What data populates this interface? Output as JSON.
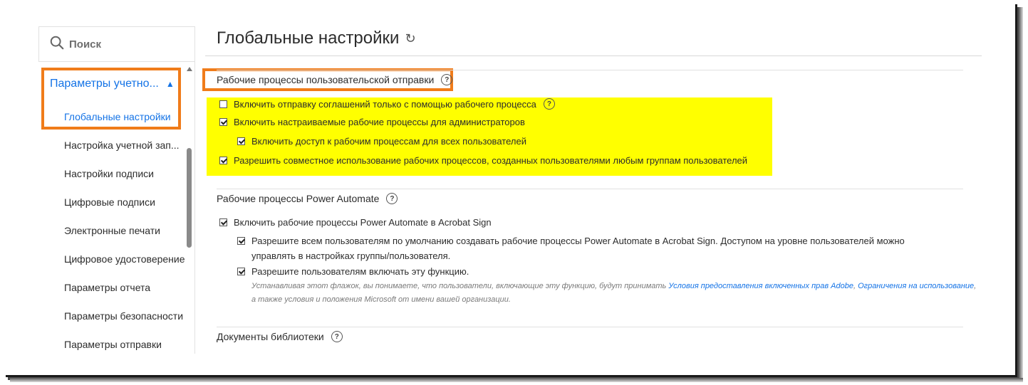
{
  "search": {
    "placeholder": "Поиск"
  },
  "sidebar": {
    "section_label": "Параметры учетно...",
    "items": [
      {
        "label": "Глобальные настройки",
        "active": true
      },
      {
        "label": "Настройка учетной зап..."
      },
      {
        "label": "Настройки подписи"
      },
      {
        "label": "Цифровые подписи"
      },
      {
        "label": "Электронные печати"
      },
      {
        "label": "Цифровое удостоверение"
      },
      {
        "label": "Параметры отчета"
      },
      {
        "label": "Параметры безопасности"
      },
      {
        "label": "Параметры отправки"
      }
    ]
  },
  "main": {
    "title": "Глобальные настройки",
    "sections": [
      {
        "title": "Рабочие процессы пользовательской отправки",
        "options": [
          {
            "label": "Включить отправку соглашений только с помощью рабочего процесса",
            "checked": false
          },
          {
            "label": "Включить настраиваемые рабочие процессы для администраторов",
            "checked": true
          },
          {
            "label": "Включить доступ к рабочим процессам для всех пользователей",
            "checked": true
          },
          {
            "label": "Разрешить совместное использование рабочих процессов, созданных пользователями любым группам пользователей",
            "checked": true
          }
        ]
      },
      {
        "title": "Рабочие процессы Power Automate",
        "options": [
          {
            "label": "Включить рабочие процессы Power Automate в Acrobat Sign",
            "checked": true
          },
          {
            "label": "Разрешите всем пользователям по умолчанию создавать рабочие процессы Power Automate в Acrobat Sign. Доступом на уровне пользователей можно управлять в настройках группы/пользователя.",
            "checked": true
          },
          {
            "label": "Разрешите пользователям включать эту функцию.",
            "checked": true
          }
        ],
        "note": {
          "prefix": "Устанавливая этот флажок, вы понимаете, что пользователи, включающие эту функцию, будут принимать ",
          "link1": "Условия предоставления включенных прав Adobe",
          "sep": ", ",
          "link2": "Ограничения на использование",
          "suffix": ", а также условия и положения Microsoft от имени вашей организации."
        }
      },
      {
        "title": "Документы библиотеки"
      }
    ]
  },
  "colors": {
    "accent": "#1473e6",
    "highlight_orange": "#f07c1a",
    "highlight_yellow": "#ffff00"
  }
}
